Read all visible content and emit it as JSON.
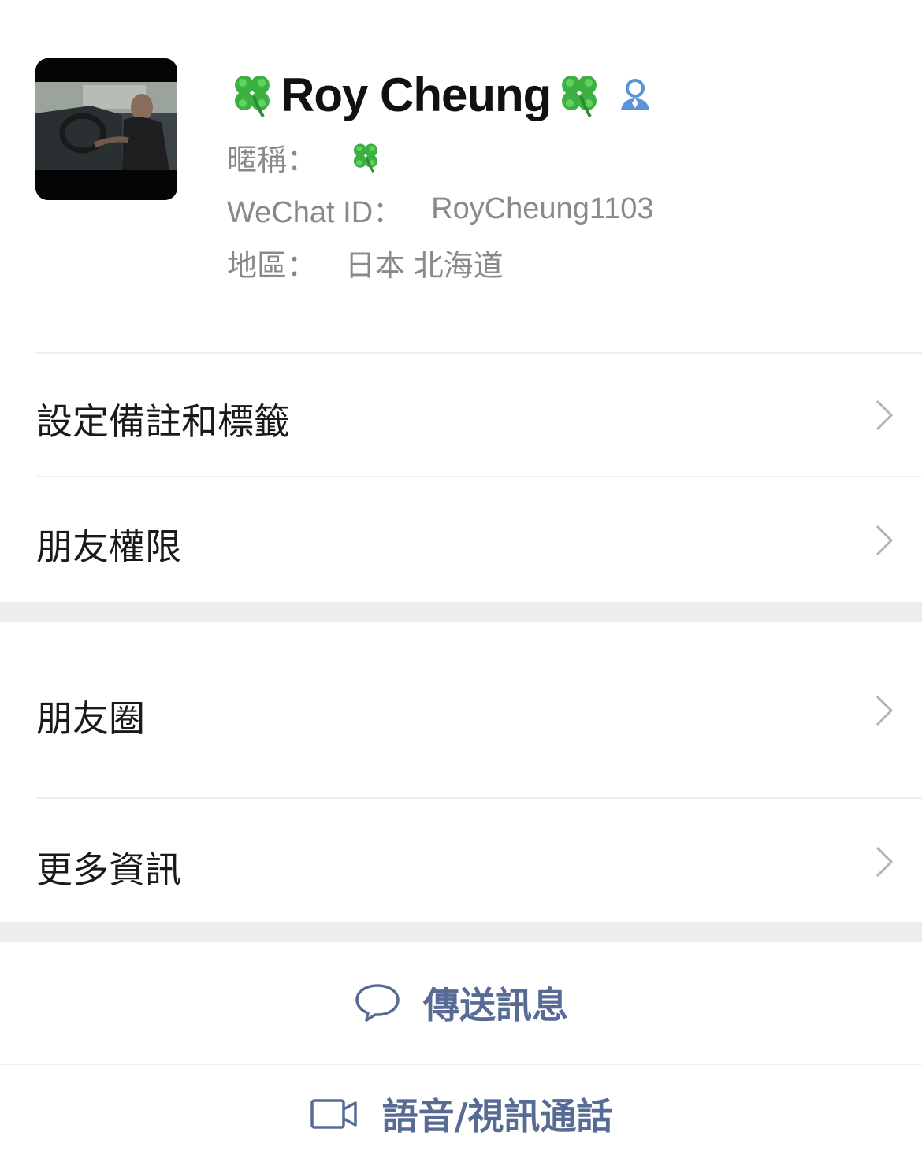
{
  "profile": {
    "display_name": "Roy Cheung",
    "name_prefix_icon": "four-leaf-clover",
    "name_suffix_icon": "four-leaf-clover",
    "contact_icon": "contact-person-icon",
    "nickname_label": "暱稱：",
    "nickname_value_icon": "four-leaf-clover",
    "wechat_id_label": "WeChat ID：",
    "wechat_id_value": "RoyCheung1103",
    "region_label": "地區：",
    "region_value": "日本 北海道",
    "avatar_description_icon": "driving-photo-avatar"
  },
  "menu": {
    "remarks_tags": "設定備註和標籤",
    "friend_permissions": "朋友權限",
    "moments": "朋友圈",
    "more_info": "更多資訊"
  },
  "actions": {
    "send_message": "傳送訊息",
    "voice_video_call": "語音/視訊通話"
  },
  "colors": {
    "accent_link": "#576b95",
    "contact_icon": "#5b93d8",
    "clover_green": "#3cb043",
    "section_gap": "#ededed",
    "secondary_text": "#888888"
  }
}
